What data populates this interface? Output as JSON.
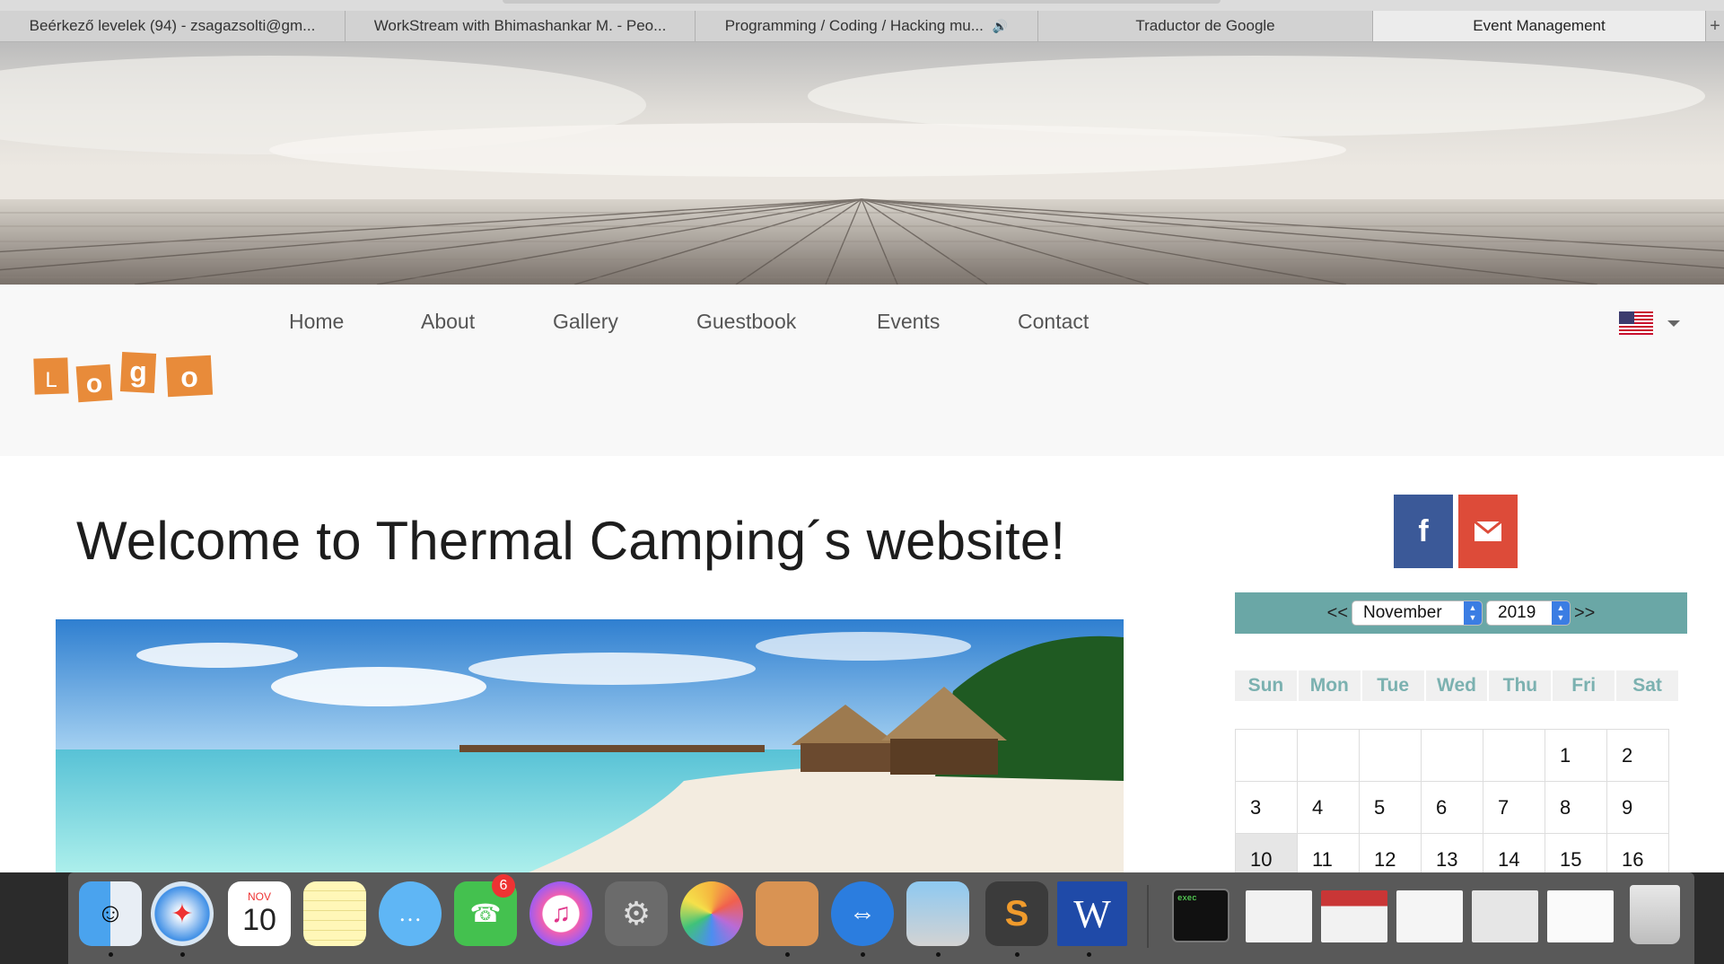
{
  "browser": {
    "tabs": [
      {
        "title": "Beérkező levelek (94) - zsagazsolti@gm...",
        "active": false
      },
      {
        "title": "WorkStream with Bhimashankar M. - Peo...",
        "active": false
      },
      {
        "title": "Programming / Coding / Hacking mu...",
        "active": false,
        "audio": "🔊"
      },
      {
        "title": "Traductor de Google",
        "active": false
      },
      {
        "title": "Event Management",
        "active": true
      }
    ],
    "new_tab": "+"
  },
  "nav": {
    "items": [
      "Home",
      "About",
      "Gallery",
      "Guestbook",
      "Events",
      "Contact"
    ],
    "logo_letters": [
      "L",
      "o",
      "g",
      "o"
    ],
    "language_icon": "us-flag-icon"
  },
  "main": {
    "title": "Welcome to Thermal Camping´s website!"
  },
  "social": {
    "facebook_icon": "f",
    "email_icon": "envelope-icon",
    "facebook_color": "#3b5998",
    "email_color": "#dd4b39"
  },
  "calendar": {
    "prev": "<<",
    "next": ">>",
    "month": "November",
    "year": "2019",
    "weekdays": [
      "Sun",
      "Mon",
      "Tue",
      "Wed",
      "Thu",
      "Fri",
      "Sat"
    ],
    "weeks": [
      [
        "",
        "",
        "",
        "",
        "",
        "1",
        "2"
      ],
      [
        "3",
        "4",
        "5",
        "6",
        "7",
        "8",
        "9"
      ],
      [
        "10",
        "11",
        "12",
        "13",
        "14",
        "15",
        "16"
      ]
    ],
    "today": "10",
    "accent": "#6aa7a6"
  },
  "dock": {
    "apps": [
      "finder-icon",
      "safari-icon",
      "calendar-icon",
      "notes-icon",
      "messages-icon",
      "facetime-icon",
      "itunes-icon",
      "system-preferences-icon",
      "photos-icon",
      "xampp-icon",
      "teamviewer-icon",
      "preview-icon",
      "sublime-text-icon",
      "word-icon",
      "terminal-icon",
      "window-thumbnail-icon",
      "window-thumbnail-icon",
      "window-thumbnail-icon",
      "window-thumbnail-icon",
      "window-thumbnail-icon",
      "trash-icon"
    ],
    "calendar_month": "NOV",
    "calendar_day": "10",
    "facetime_badge": "6",
    "word_letter": "W",
    "terminal_label": "exec"
  }
}
